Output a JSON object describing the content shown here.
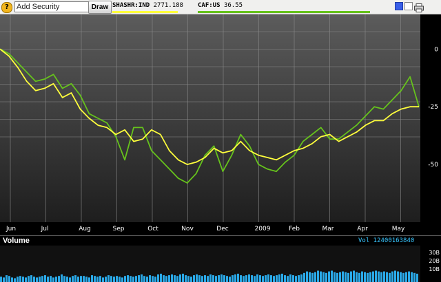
{
  "toolbar": {
    "help_glyph": "?",
    "search_value": "Add Security",
    "draw_label": "Draw"
  },
  "legend": [
    {
      "ticker": "SHASHR:IND",
      "value": "2771.188",
      "color": "#ffff3c"
    },
    {
      "ticker": "CAF:US",
      "value": "36.55",
      "color": "#66c21c"
    }
  ],
  "controls": [
    "color-scheme-blue",
    "color-scheme-white",
    "print-icon"
  ],
  "chart_data": {
    "type": "line",
    "x_labels": [
      "Jun",
      "Jul",
      "Aug",
      "Sep",
      "Oct",
      "Nov",
      "Dec",
      "2009",
      "Feb",
      "Mar",
      "Apr",
      "May"
    ],
    "y_ticks": [
      "0",
      "-25",
      "-50"
    ],
    "ylim": [
      -75,
      15
    ],
    "grid": true,
    "series": [
      {
        "name": "SHASHR:IND",
        "color": "#ffff3c",
        "values": [
          0,
          -3,
          -8,
          -14,
          -18,
          -17,
          -15,
          -21,
          -19,
          -26,
          -30,
          -33,
          -34,
          -37,
          -35,
          -40,
          -39,
          -35,
          -37,
          -44,
          -48,
          -50,
          -49,
          -47,
          -43,
          -45,
          -44,
          -40,
          -44,
          -46,
          -47,
          -48,
          -46,
          -44,
          -43,
          -41,
          -38,
          -37,
          -40,
          -38,
          -36,
          -33,
          -31,
          -31,
          -28,
          -26,
          -25,
          -25
        ]
      },
      {
        "name": "CAF:US",
        "color": "#66c21c",
        "values": [
          0,
          -2,
          -6,
          -10,
          -14,
          -13,
          -11,
          -17,
          -15,
          -20,
          -28,
          -30,
          -32,
          -38,
          -48,
          -34,
          -34,
          -44,
          -48,
          -52,
          -56,
          -58,
          -54,
          -46,
          -42,
          -53,
          -46,
          -37,
          -42,
          -50,
          -52,
          -53,
          -49,
          -46,
          -40,
          -37,
          -34,
          -39,
          -39,
          -36,
          -33,
          -29,
          -25,
          -26,
          -22,
          -18,
          -12,
          -25
        ]
      }
    ]
  },
  "volume": {
    "title": "Volume",
    "label": "Vol 12400163840",
    "ticks": [
      "30B",
      "20B",
      "10B"
    ],
    "bars": [
      7,
      6,
      9,
      8,
      6,
      5,
      7,
      8,
      7,
      6,
      8,
      9,
      7,
      6,
      7,
      8,
      9,
      7,
      8,
      6,
      7,
      8,
      10,
      8,
      7,
      6,
      8,
      9,
      7,
      8,
      8,
      7,
      6,
      9,
      8,
      7,
      8,
      6,
      7,
      9,
      8,
      7,
      8,
      7,
      6,
      8,
      9,
      8,
      7,
      8,
      9,
      10,
      8,
      7,
      9,
      8,
      7,
      10,
      11,
      9,
      8,
      9,
      10,
      9,
      8,
      10,
      11,
      9,
      8,
      7,
      9,
      10,
      9,
      8,
      9,
      8,
      10,
      9,
      8,
      9,
      10,
      9,
      8,
      7,
      9,
      10,
      11,
      9,
      8,
      9,
      10,
      9,
      8,
      10,
      9,
      8,
      9,
      10,
      9,
      8,
      9,
      10,
      11,
      9,
      8,
      10,
      9,
      8,
      9,
      10,
      12,
      14,
      13,
      12,
      13,
      15,
      14,
      13,
      12,
      14,
      15,
      13,
      12,
      13,
      14,
      13,
      12,
      14,
      15,
      13,
      12,
      14,
      13,
      12,
      13,
      14,
      15,
      14,
      13,
      14,
      13,
      12,
      14,
      15,
      14,
      13,
      12,
      13,
      14,
      13,
      12,
      11
    ]
  }
}
